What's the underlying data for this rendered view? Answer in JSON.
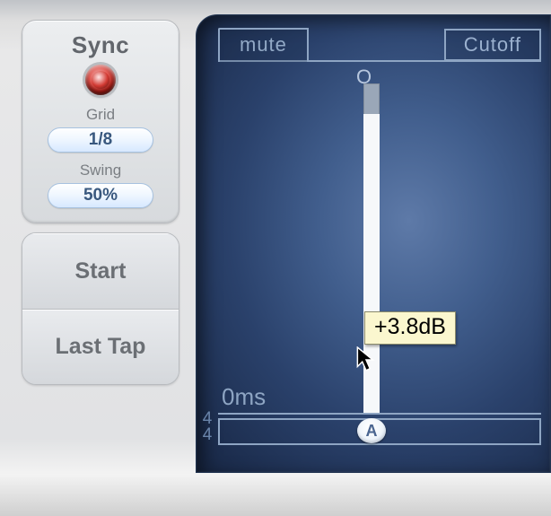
{
  "sync": {
    "title": "Sync",
    "grid_label": "Grid",
    "grid_value": "1/8",
    "swing_label": "Swing",
    "swing_value": "50%"
  },
  "buttons": {
    "start": "Start",
    "last_tap": "Last Tap"
  },
  "display": {
    "mute_tab": "mute",
    "cutoff_button": "Cutoff",
    "zero_marker": "O",
    "time_readout": "0ms",
    "timesig_num": "4",
    "timesig_den": "4",
    "tap_marker": "A",
    "tooltip_value": "+3.8dB"
  }
}
